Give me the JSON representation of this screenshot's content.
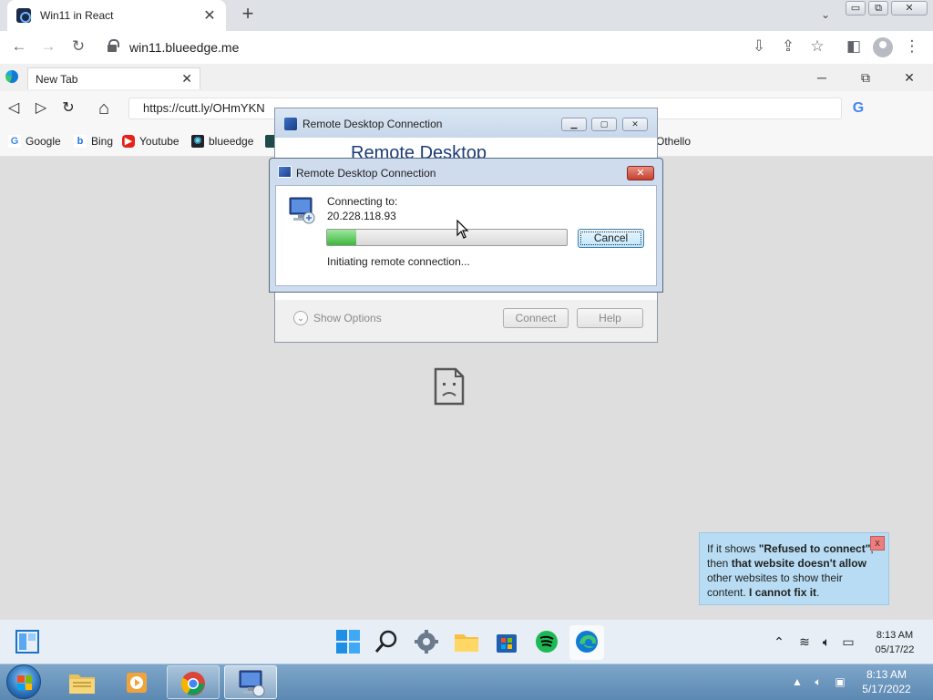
{
  "chrome": {
    "tab_title": "Win11 in React",
    "new_tab_symbol": "+",
    "tab_close_symbol": "✕",
    "url": "win11.blueedge.me"
  },
  "edge": {
    "tab_title": "New Tab",
    "tab_close_symbol": "✕",
    "address": "https://cutt.ly/OHmYKN",
    "bookmarks": [
      {
        "label": "Google",
        "icon": "google-icon"
      },
      {
        "label": "Bing",
        "icon": "bing-icon"
      },
      {
        "label": "Youtube",
        "icon": "youtube-icon"
      },
      {
        "label": "blueedge",
        "icon": "react-icon"
      },
      {
        "label": "Othello",
        "icon": "othello-icon"
      }
    ]
  },
  "rdc_back": {
    "title": "Remote Desktop Connection",
    "banner": "Remote Desktop",
    "show_options": "Show Options",
    "connect": "Connect",
    "help": "Help"
  },
  "rdc_dialog": {
    "title": "Remote Desktop Connection",
    "connecting_label": "Connecting to:",
    "ip": "20.228.118.93",
    "cancel": "Cancel",
    "status": "Initiating remote connection...",
    "progress": 0.12
  },
  "note": {
    "p1": "If it shows ",
    "b1": "\"Refused to connect\"",
    "p2": ", then ",
    "b2": "that website doesn't allow",
    "p3": " other websites to show their content. ",
    "b3": "I cannot fix it",
    "p4": ".",
    "close": "x"
  },
  "win11_taskbar": {
    "time": "8:13 AM",
    "date": "05/17/22"
  },
  "win7_taskbar": {
    "time": "8:13 AM",
    "date": "5/17/2022"
  },
  "colors": {
    "tooltip_bg": "#b7dcf3",
    "win7_taskbar": "#6a94bd",
    "progress_fill": "#3fb63f"
  }
}
